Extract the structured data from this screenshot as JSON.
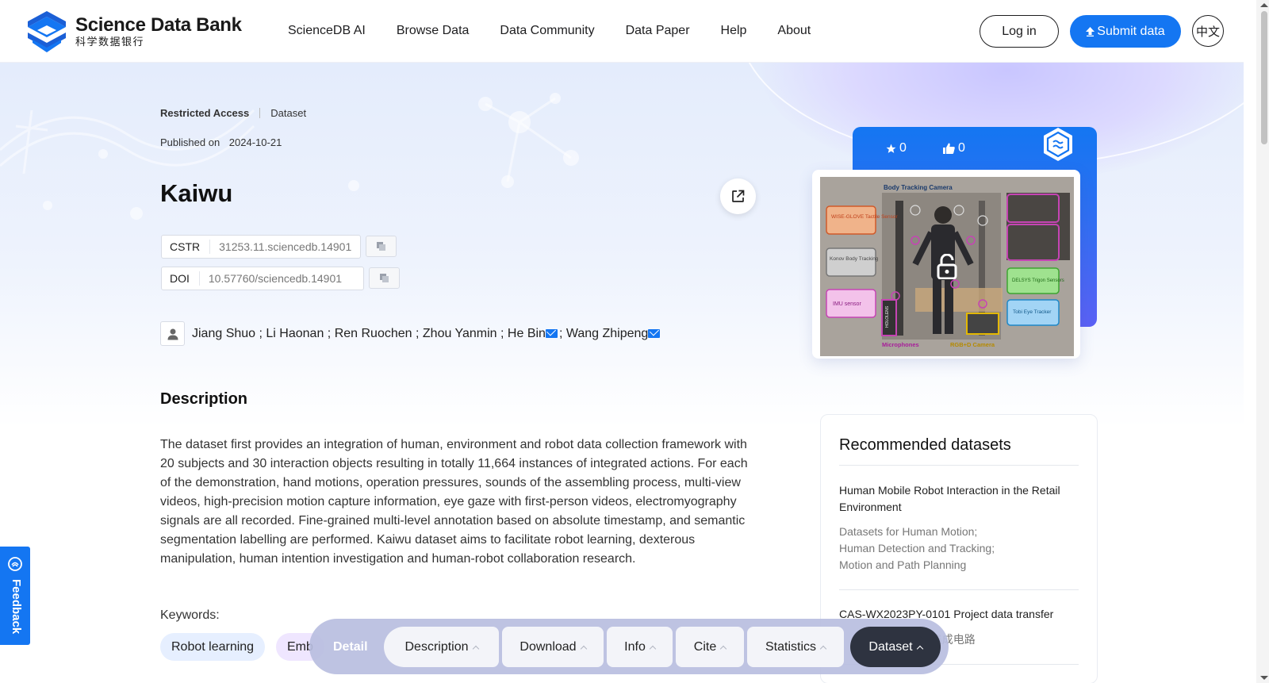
{
  "brand": {
    "name_en": "Science Data Bank",
    "name_zh": "科学数据银行",
    "color": "#1476f2"
  },
  "nav": [
    {
      "label": "ScienceDB AI"
    },
    {
      "label": "Browse Data"
    },
    {
      "label": "Data Community"
    },
    {
      "label": "Data Paper"
    },
    {
      "label": "Help"
    },
    {
      "label": "About"
    }
  ],
  "header": {
    "login": "Log in",
    "submit": "Submit data",
    "lang": "中文"
  },
  "dataset": {
    "access": "Restricted Access",
    "type": "Dataset",
    "published_label": "Published on",
    "published_date": "2024-10-21",
    "title": "Kaiwu",
    "cstr_label": "CSTR",
    "cstr": "31253.11.sciencedb.14901",
    "doi_label": "DOI",
    "doi": "10.57760/sciencedb.14901",
    "authors": [
      "Jiang Shuo",
      "Li Haonan",
      "Ren Ruochen",
      "Zhou Yanmin",
      "He Bin",
      "Wang Zhipeng"
    ],
    "author_sep": " ; ",
    "description_heading": "Description",
    "description": "The dataset first provides an integration of human, environment and robot data collection framework with 20 subjects and 30 interaction objects resulting in totally 11,664 instances of integrated actions. For each of the demonstration, hand motions, operation pressures, sounds of the assembling process, multi-view videos, high-precision motion capture information, eye gaze with first-person videos, electromyography signals are all recorded. Fine-grained multi-level annotation based on absolute timestamp, and semantic segmentation labelling are performed. Kaiwu dataset aims to facilitate robot learning, dexterous manipulation, human intention investigation and human-robot collaboration research.",
    "keywords_label": "Keywords:",
    "keywords": [
      "Robot learning",
      "Emb"
    ]
  },
  "stats": {
    "stars": "0",
    "likes": "0"
  },
  "image_labels": {
    "top": "Body Tracking Camera",
    "left1": "WISE-GLOVE Tactile Sensor",
    "left2": "Konov Body Tracking",
    "left3": "IMU sensor",
    "right1": "DELSYS Trigon Sensors",
    "right2": "Tobi Eye Tracker",
    "bottom1": "Microphones",
    "bottom2": "RGB+D Camera",
    "side": "HOLOLENS"
  },
  "recommended": {
    "heading": "Recommended datasets",
    "items": [
      {
        "title": "Human Mobile Robot Interaction in the Retail Environment",
        "tags": [
          "Datasets for Human Motion;",
          "Human Detection and Tracking;",
          "Motion and Path Planning"
        ]
      },
      {
        "title": "CAS-WX2023PY-0101 Project data transfer",
        "tags": [
          "能; 集成电路"
        ]
      }
    ]
  },
  "bottom_nav": {
    "label": "Detail",
    "tabs": [
      "Description",
      "Download",
      "Info",
      "Cite",
      "Statistics",
      "Dataset"
    ]
  },
  "feedback": "Feedback"
}
